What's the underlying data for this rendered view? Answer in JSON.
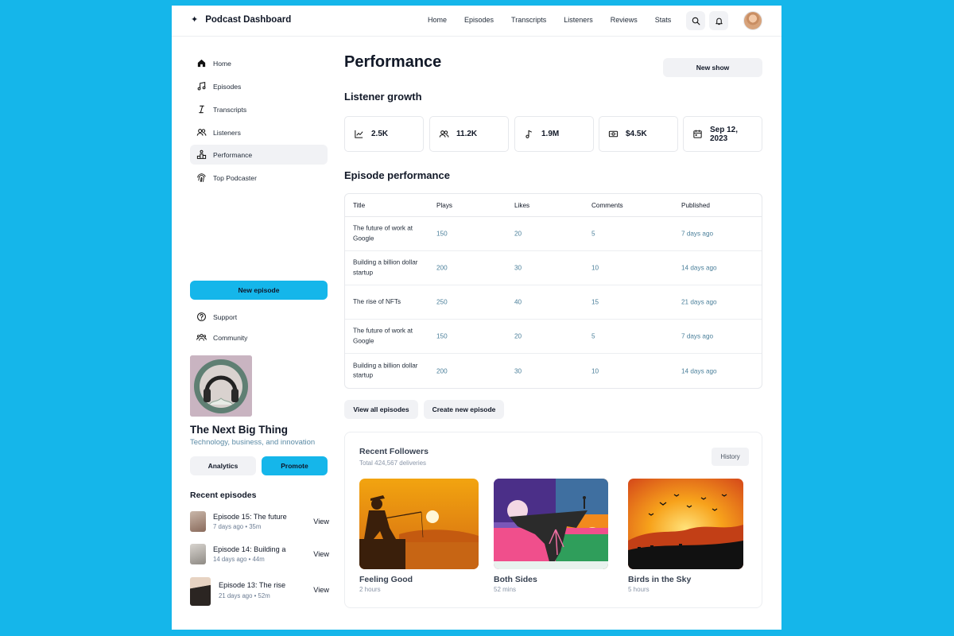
{
  "app": {
    "title": "Podcast Dashboard"
  },
  "nav": {
    "items": [
      "Home",
      "Episodes",
      "Transcripts",
      "Listeners",
      "Reviews",
      "Stats"
    ]
  },
  "sidebar": {
    "items": [
      {
        "label": "Home",
        "icon": "home-icon"
      },
      {
        "label": "Episodes",
        "icon": "music-note-icon"
      },
      {
        "label": "Transcripts",
        "icon": "text-cursor-icon"
      },
      {
        "label": "Listeners",
        "icon": "users-icon"
      },
      {
        "label": "Performance",
        "icon": "podium-icon",
        "active": true
      },
      {
        "label": "Top Podcaster",
        "icon": "fingerprint-icon"
      }
    ],
    "new_episode": "New episode",
    "support": "Support",
    "community": "Community",
    "show": {
      "title": "The Next Big Thing",
      "subtitle": "Technology, business, and innovation"
    },
    "analytics": "Analytics",
    "promote": "Promote",
    "recent_heading": "Recent episodes",
    "recent": [
      {
        "title": "Episode 15: The future",
        "meta": "7 days ago • 35m",
        "action": "View"
      },
      {
        "title": "Episode 14: Building a",
        "meta": "14 days ago • 44m",
        "action": "View"
      },
      {
        "title": "Episode 13: The rise",
        "meta": "21 days ago • 52m",
        "action": "View"
      }
    ]
  },
  "main": {
    "title": "Performance",
    "new_show": "New show",
    "growth_heading": "Listener growth",
    "stats": [
      {
        "value": "2.5K",
        "icon": "trend-chart-icon"
      },
      {
        "value": "11.2K",
        "icon": "users-icon"
      },
      {
        "value": "1.9M",
        "icon": "music-note-icon"
      },
      {
        "value": "$4.5K",
        "icon": "banknote-icon"
      },
      {
        "value": "Sep 12, 2023",
        "icon": "calendar-icon"
      }
    ],
    "episode_heading": "Episode performance",
    "columns": [
      "Title",
      "Plays",
      "Likes",
      "Comments",
      "Published"
    ],
    "rows": [
      [
        "The future of work at Google",
        "150",
        "20",
        "5",
        "7 days ago"
      ],
      [
        "Building a billion dollar startup",
        "200",
        "30",
        "10",
        "14 days ago"
      ],
      [
        "The rise of NFTs",
        "250",
        "40",
        "15",
        "21 days ago"
      ],
      [
        "The future of work at Google",
        "150",
        "20",
        "5",
        "7 days ago"
      ],
      [
        "Building a billion dollar startup",
        "200",
        "30",
        "10",
        "14 days ago"
      ]
    ],
    "view_all": "View all episodes",
    "create_new": "Create new episode",
    "followers": {
      "title": "Recent Followers",
      "subtitle": "Total 424,567 deliveries",
      "history": "History",
      "cards": [
        {
          "name": "Feeling Good",
          "duration": "2 hours"
        },
        {
          "name": "Both Sides",
          "duration": "52 mins"
        },
        {
          "name": "Birds in the Sky",
          "duration": "5 hours"
        }
      ]
    }
  },
  "colors": {
    "accent": "#15b6ea",
    "muted_blue": "#4a7f9a",
    "soft_bg": "#f1f2f5"
  }
}
